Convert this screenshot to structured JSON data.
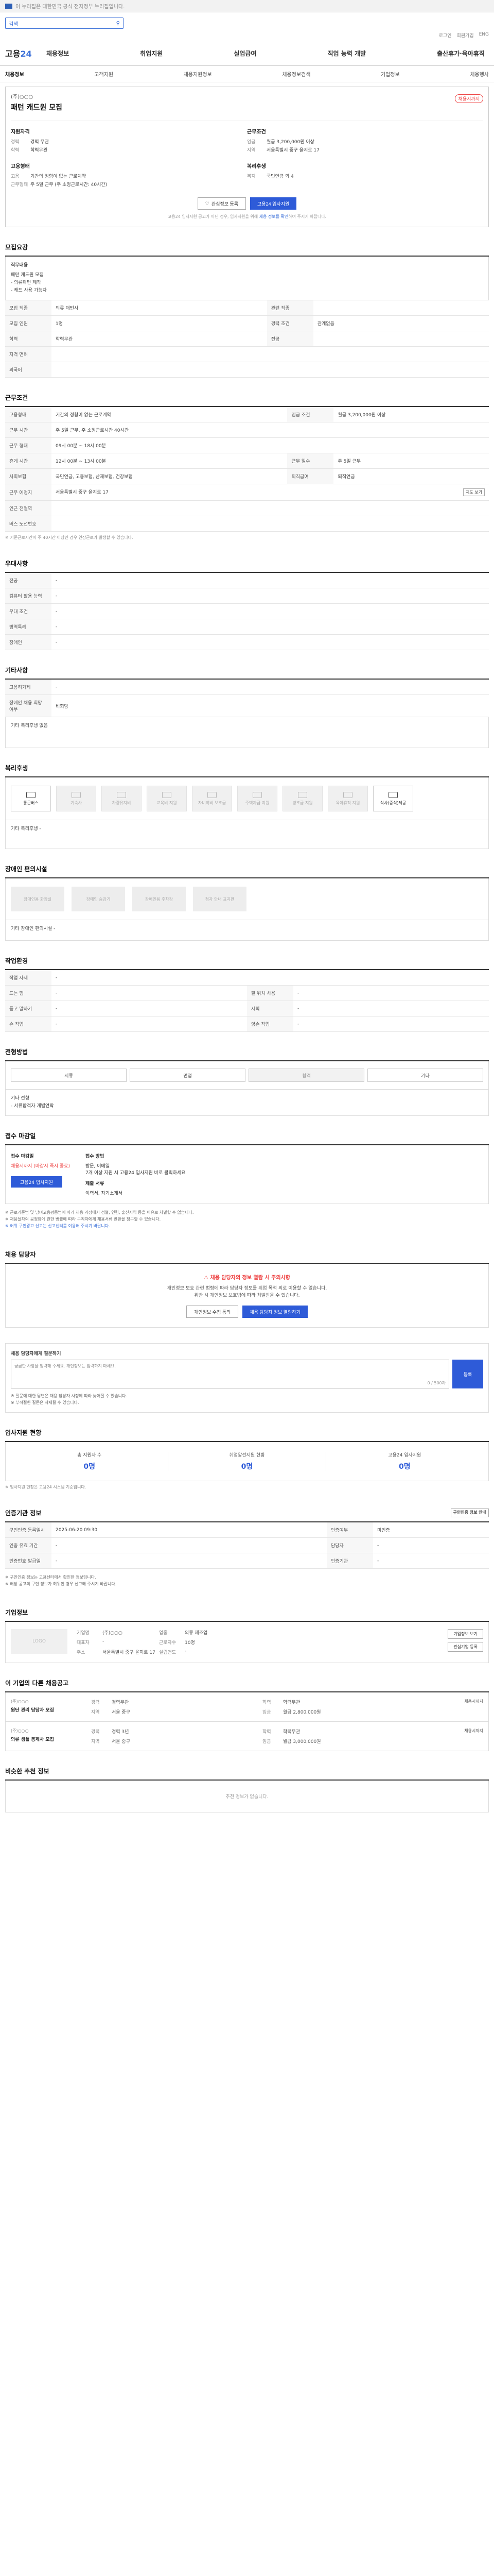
{
  "topbar": {
    "notice": "이 누리집은 대한민국 공식 전자정부 누리집입니다."
  },
  "search": {
    "placeholder": "검색",
    "icon": "search-icon"
  },
  "util": [
    "로그인",
    "회원가입",
    "ENG"
  ],
  "brand": {
    "logo_main": "고용",
    "logo_num": "24"
  },
  "gnb": [
    "채용정보",
    "취업지원",
    "실업급여",
    "직업 능력 개발",
    "출산휴가·육아휴직"
  ],
  "lnb": [
    "채용정보",
    "고객지원",
    "채용지원정보",
    "채용정보검색",
    "기업정보",
    "채용행사"
  ],
  "job": {
    "company": "(주)○○○",
    "title": "패턴 캐드원 모집",
    "badge": "채용시까지",
    "qual_title": "지원자격",
    "qual": [
      {
        "k": "경력",
        "v": "경력 무관"
      },
      {
        "k": "학력",
        "v": "학력무관"
      }
    ],
    "cond_title": "근무조건",
    "cond": [
      {
        "k": "임금",
        "v": "월급 3,200,000원 이상"
      },
      {
        "k": "지역",
        "v": "서울특별시 중구 을지로 17"
      }
    ],
    "form_title": "고용형태",
    "form": [
      {
        "k": "고용",
        "v": "기간의 정함이 없는 근로계약"
      },
      {
        "k": "근무형태",
        "v": "주 5일 근무 (주 소정근로시간: 40시간)"
      }
    ],
    "welfare_title": "복리후생",
    "welfare": [
      {
        "k": "복지",
        "v": "국민연금 외 4"
      }
    ]
  },
  "actions": {
    "scrap": "관심정보 등록",
    "apply": "고용24 입사지원"
  },
  "notice": {
    "text": "고용24 입사지원 공고가 아닌 경우, 입사지원을 위해 ",
    "link": "채용 정보를 확인",
    "tail": "하여 주시기 바랍니다."
  },
  "recruit": {
    "title": "모집요강",
    "duty_label": "직무내용",
    "duty": [
      "패턴 캐드원 모집",
      "- 의류패턴 제작",
      "- 캐드 사용 가능자"
    ],
    "rows": [
      {
        "k": "모집 직종",
        "v": "의류 패턴사",
        "k2": "관련 직종",
        "v2": ""
      },
      {
        "k": "모집 인원",
        "v": "1명",
        "k2": "경력 조건",
        "v2": "관계없음"
      },
      {
        "k": "학력",
        "v": "학력무관",
        "k2": "전공",
        "v2": ""
      },
      {
        "k": "자격 면허",
        "v": "",
        "k2": "",
        "v2": ""
      },
      {
        "k": "외국어",
        "v": "",
        "k2": "",
        "v2": ""
      }
    ]
  },
  "conditions": {
    "title": "근무조건",
    "rows": [
      {
        "k": "고용형태",
        "v": "기간의 정함이 없는 근로계약",
        "k2": "임금 조건",
        "v2": "월급 3,200,000원 이상"
      },
      {
        "k": "근무 시간",
        "v": "주 5일 근무, 주 소정근로시간 40시간",
        "k2": "",
        "v2": ""
      },
      {
        "k": "근무 형태",
        "v": "09시 00분 ~ 18시 00분",
        "k2": "",
        "v2": ""
      },
      {
        "k": "휴게 시간",
        "v": "12시 00분 ~ 13시 00분",
        "k2": "근무 일수",
        "v2": "주 5일 근무"
      },
      {
        "k": "사회보험",
        "v": "국민연금, 고용보험, 산재보험, 건강보험",
        "k2": "퇴직급여",
        "v2": "퇴직연금"
      },
      {
        "k": "근무 예정지",
        "v": "서울특별시 중구 을지로 17",
        "k2": "",
        "v2": ""
      },
      {
        "k": "인근 전철역",
        "v": "",
        "k2": "",
        "v2": ""
      },
      {
        "k": "버스 노선번호",
        "v": "",
        "k2": "",
        "v2": ""
      }
    ],
    "map_btn": "지도 보기",
    "note": "※ 기준근로시간이 주 40시간 이상인 경우 연장근로가 발생할 수 있습니다."
  },
  "preferred": {
    "title": "우대사항",
    "rows": [
      {
        "k": "전공",
        "v": "-"
      },
      {
        "k": "컴퓨터 활용 능력",
        "v": "-"
      },
      {
        "k": "우대 조건",
        "v": "-"
      },
      {
        "k": "병역특례",
        "v": "-"
      },
      {
        "k": "장애인",
        "v": "-"
      }
    ]
  },
  "etc": {
    "title": "기타사항",
    "rows": [
      {
        "k": "고용허가제",
        "v": "-"
      },
      {
        "k": "장애인 채용 희망 여부",
        "v": "비희망"
      }
    ],
    "extra": "기타 복리후생 없음"
  },
  "welfare": {
    "title": "복리후생",
    "tiles": [
      {
        "label": "통근버스",
        "on": true
      },
      {
        "label": "기숙사",
        "on": false
      },
      {
        "label": "차량유지비",
        "on": false
      },
      {
        "label": "교육비 지원",
        "on": false
      },
      {
        "label": "자녀학비 보조금",
        "on": false
      },
      {
        "label": "주택자금 지원",
        "on": false
      },
      {
        "label": "경조금 지원",
        "on": false
      },
      {
        "label": "육아휴직 지원",
        "on": false
      },
      {
        "label": "식사(중식)제공",
        "on": true
      }
    ],
    "extra_label": "기타 복리후생",
    "extra": "-"
  },
  "disability": {
    "title": "장애인 편의시설",
    "tiles": [
      "장애인용 화장실",
      "장애인 승강기",
      "장애인용 주차장",
      "점자 안내 표지판"
    ],
    "extra": "기타 장애인 편의시설 -"
  },
  "env": {
    "title": "작업환경",
    "rows": [
      {
        "k": "작업 자세",
        "v": "-",
        "k2": "",
        "v2": ""
      },
      {
        "k": "드는 힘",
        "v": "-",
        "k2": "팔 위치 사용",
        "v2": "-"
      },
      {
        "k": "듣고 말하기",
        "v": "-",
        "k2": "시력",
        "v2": "-"
      },
      {
        "k": "손 작업",
        "v": "-",
        "k2": "양손 작업",
        "v2": "-"
      }
    ]
  },
  "process": {
    "title": "전형방법",
    "steps": [
      "서류",
      "면접",
      "합격",
      "기타"
    ],
    "extra_label": "기타 전형",
    "extra": "- 서류합격자 개별연락"
  },
  "apply": {
    "title": "접수 마감일",
    "deadline": "채용시까지 (마감시 즉시 종료)",
    "method_title": "접수 방법",
    "methods": [
      "방문, 이메일",
      "7개 이상 지원 시 고용24 입사지원 바로 클릭하세요"
    ],
    "docs_title": "제출 서류",
    "docs": "이력서, 자기소개서",
    "btn": "고용24 입사지원"
  },
  "warnings": [
    "※ 근로기준법 및 남녀고용평등법에 따라 채용 과정에서 성별, 연령, 출신지역 등을 이유로 차별할 수 없습니다.",
    "※ 채용절차의 공정화에 관한 법률에 따라 구직자에게 채용서류 반환을 청구할 수 있습니다.",
    "※ 허위 구인광고 신고는 신고센터를 이용해 주시기 바랍니다."
  ],
  "contact": {
    "title": "채용 담당자",
    "alert": "채용 담당자의 정보 열람 시 주의사항",
    "body": [
      "개인정보 보호 관련 법령에 따라 담당자 정보를 취업 목적 외로 이용할 수 없습니다.",
      "위반 시 개인정보 보호법에 따라 처벌받을 수 있습니다."
    ],
    "btn1": "개인정보 수집 동의",
    "btn2": "채용 담당자 정보 열람하기"
  },
  "inquiry": {
    "title": "채용 담당자에게 질문하기",
    "placeholder": "궁금한 사항을 입력해 주세요. 개인정보는 입력하지 마세요.",
    "count": "0 / 500자",
    "btn": "등록",
    "notes": [
      "※ 질문에 대한 답변은 채용 담당자 사정에 따라 늦어질 수 있습니다.",
      "※ 부적절한 질문은 삭제될 수 있습니다."
    ]
  },
  "status": {
    "title": "입사지원 현황",
    "items": [
      {
        "label": "총 지원자 수",
        "value": "0명"
      },
      {
        "label": "취업알선지원 현황",
        "value": "0명"
      },
      {
        "label": "고용24 입사지원",
        "value": "0명"
      }
    ],
    "note": "※ 입사지원 현황은 고용24 시스템 기준입니다."
  },
  "info": {
    "title": "인증기관 정보",
    "btn": "구인인증 정보 안내",
    "rows": [
      {
        "k": "구인인증 등록일시",
        "v": "2025-06-20 09:30",
        "k2": "인증여부",
        "v2": "미인증"
      },
      {
        "k": "인증 유효 기간",
        "v": "-",
        "k2": "담당자",
        "v2": "-"
      },
      {
        "k": "인증번호 발급일",
        "v": "-",
        "k2": "인증기관",
        "v2": "-"
      }
    ],
    "notes": [
      "※ 구인인증 정보는 고용센터에서 확인한 정보입니다.",
      "※ 해당 공고의 구인 정보가 허위인 경우 신고해 주시기 바랍니다."
    ]
  },
  "company": {
    "title": "기업정보",
    "logo": "LOGO",
    "cells": [
      {
        "k": "기업명",
        "v": "(주)○○○"
      },
      {
        "k": "업종",
        "v": "의류 제조업"
      },
      {
        "k": "대표자",
        "v": "-"
      },
      {
        "k": "근로자수",
        "v": "10명"
      },
      {
        "k": "주소",
        "v": "서울특별시 중구 을지로 17"
      },
      {
        "k": "설립연도",
        "v": "-"
      }
    ],
    "btns": [
      "기업정보 보기",
      "관심기업 등록"
    ]
  },
  "recommend": {
    "title": "이 기업의 다른 채용공고",
    "items": [
      {
        "company": "(주)○○○",
        "title": "원단 관리 담당자 모집",
        "grid": [
          {
            "k": "경력",
            "v": "경력무관"
          },
          {
            "k": "학력",
            "v": "학력무관"
          },
          {
            "k": "지역",
            "v": "서울 중구"
          },
          {
            "k": "임금",
            "v": "월급 2,800,000원"
          }
        ],
        "right": "채용시까지"
      },
      {
        "company": "(주)○○○",
        "title": "의류 샘플 봉제사 모집",
        "grid": [
          {
            "k": "경력",
            "v": "경력 3년"
          },
          {
            "k": "학력",
            "v": "학력무관"
          },
          {
            "k": "지역",
            "v": "서울 중구"
          },
          {
            "k": "임금",
            "v": "월급 3,000,000원"
          }
        ],
        "right": "채용시까지"
      }
    ]
  },
  "similar": {
    "title": "비슷한 추천 정보",
    "empty": "추천 정보가 없습니다."
  }
}
